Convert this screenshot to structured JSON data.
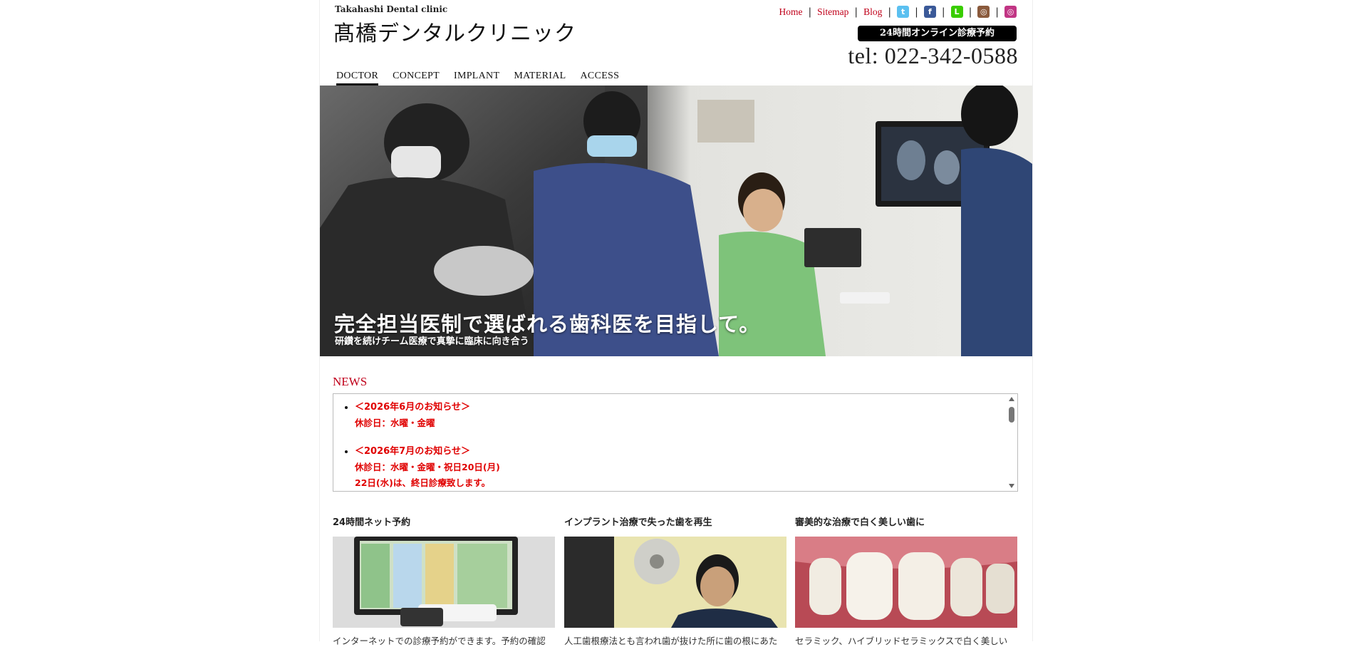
{
  "header": {
    "logo_sub": "Takahashi Dental clinic",
    "logo_main": "髙橋デンタルクリニック",
    "links": [
      "Home",
      "Sitemap",
      "Blog"
    ],
    "sns": [
      {
        "name": "twitter-icon",
        "glyph": "t",
        "color": "#5bc0f0"
      },
      {
        "name": "facebook-icon",
        "glyph": "f",
        "color": "#3b5998"
      },
      {
        "name": "line-icon",
        "glyph": "L",
        "color": "#39cd00"
      },
      {
        "name": "instagram-icon",
        "glyph": "◎",
        "color": "#8a5a3c"
      },
      {
        "name": "instagram-icon-2",
        "glyph": "◎",
        "color": "#c13584"
      }
    ],
    "reserve_label": "24時間オンライン診療予約",
    "tel": "tel: 022-342-0588"
  },
  "nav": [
    "DOCTOR",
    "CONCEPT",
    "IMPLANT",
    "MATERIAL",
    "ACCESS"
  ],
  "hero": {
    "title": "完全担当医制で選ばれる歯科医を目指して。",
    "subtitle": "研鑽を続けチーム医療で真摯に臨床に向き合う"
  },
  "news": {
    "heading": "NEWS",
    "items": [
      {
        "title": "＜2026年6月のお知らせ＞",
        "lines": [
          "休診日：水曜・金曜"
        ]
      },
      {
        "title": "＜2026年7月のお知らせ＞",
        "lines": [
          "休診日：水曜・金曜・祝日20日(月)",
          "22日(水)は、終日診療致します。"
        ]
      }
    ]
  },
  "features": [
    {
      "title": "24時間ネット予約",
      "desc": "インターネットでの診療予約ができます。予約の確認"
    },
    {
      "title": "インプラント治療で失った歯を再生",
      "desc": "人工歯根療法とも言われ歯が抜けた所に歯の根にあた"
    },
    {
      "title": "審美的な治療で白く美しい歯に",
      "desc": "セラミック、ハイブリッドセラミックスで白く美しい"
    }
  ],
  "colors": {
    "accent": "#c0001a",
    "news_text": "#e00000"
  }
}
